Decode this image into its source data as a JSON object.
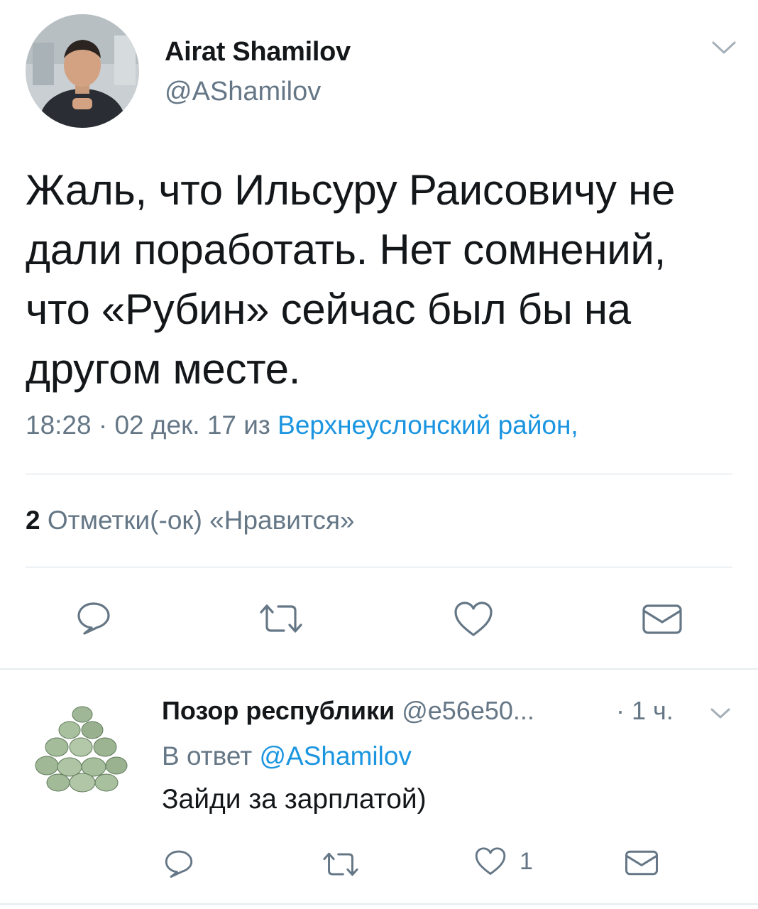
{
  "tweet": {
    "author_name": "Airat Shamilov",
    "author_handle": "@AShamilov",
    "text": "Жаль, что Ильсуру Раисовичу не дали поработать. Нет сомнений, что «Рубин» сейчас был бы на другом месте.",
    "time": "18:28 · 02 дек. 17 из ",
    "location": "Верхнеуслонский район,",
    "likes_count": "2",
    "likes_label": "Отметки(-ок) «Нравится»"
  },
  "reply": {
    "author_name": "Позор республики",
    "author_handle": "@e56e50...",
    "time": "· 1 ч.",
    "reply_to_prefix": "В ответ ",
    "reply_to_mention": "@AShamilov",
    "text": "Зайди за зарплатой)",
    "like_count": "1"
  },
  "colors": {
    "link": "#1b95e0",
    "secondary_text": "#657786",
    "primary_text": "#14171a"
  },
  "icons": [
    "chevron-down-icon",
    "reply-icon",
    "retweet-icon",
    "heart-icon",
    "envelope-icon"
  ]
}
